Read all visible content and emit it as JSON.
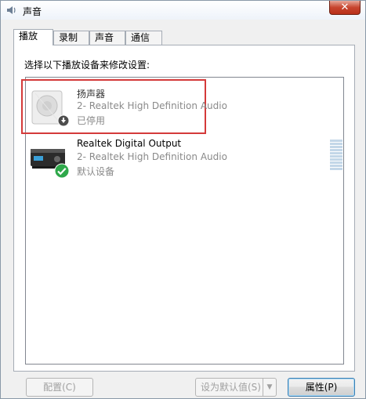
{
  "window": {
    "title": "声音",
    "close_label": "✕"
  },
  "tabs": [
    {
      "label": "播放",
      "active": true
    },
    {
      "label": "录制",
      "active": false
    },
    {
      "label": "声音",
      "active": false
    },
    {
      "label": "通信",
      "active": false
    }
  ],
  "instruction": "选择以下播放设备来修改设置:",
  "devices": [
    {
      "name": "扬声器",
      "driver": "2- Realtek High Definition Audio",
      "status": "已停用",
      "icon": "speaker-icon",
      "badge": "disabled-badge-icon"
    },
    {
      "name": "Realtek Digital Output",
      "driver": "2- Realtek High Definition Audio",
      "status": "默认设备",
      "icon": "receiver-icon",
      "badge": "default-check-icon"
    }
  ],
  "buttons": {
    "configure": "配置(C)",
    "set_default": "设为默认值(S)",
    "properties": "属性(P)"
  },
  "colors": {
    "highlight": "#d43a3a",
    "close_button": "#c7452f",
    "default_check": "#2ea84a"
  }
}
